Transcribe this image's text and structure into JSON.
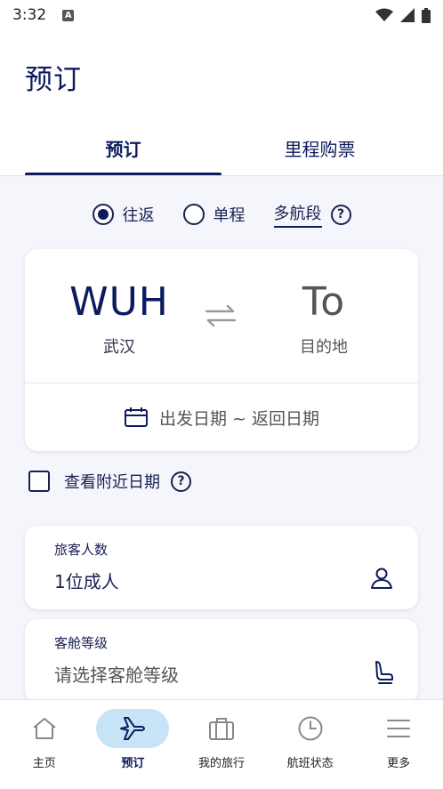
{
  "status_bar": {
    "time": "3:32",
    "notification_icon": "A"
  },
  "header": {
    "title": "预订",
    "tabs": [
      {
        "label": "预订",
        "active": true
      },
      {
        "label": "里程购票",
        "active": false
      }
    ]
  },
  "trip_type": {
    "options": [
      {
        "label": "往返",
        "selected": true
      },
      {
        "label": "单程",
        "selected": false
      }
    ],
    "multi_city_label": "多航段",
    "help": "?"
  },
  "route": {
    "origin_code": "WUH",
    "origin_city": "武汉",
    "dest_code": "To",
    "dest_city": "目的地",
    "date_placeholder": "出发日期 ~ 返回日期"
  },
  "nearby_dates": {
    "label": "查看附近日期",
    "checked": false,
    "help": "?"
  },
  "passengers": {
    "label": "旅客人数",
    "value": "1位成人"
  },
  "cabin": {
    "label": "客舱等级",
    "placeholder": "请选择客舱等级"
  },
  "bottom_nav": [
    {
      "label": "主页",
      "icon": "home-icon",
      "active": false
    },
    {
      "label": "预订",
      "icon": "airplane-icon",
      "active": true
    },
    {
      "label": "我的旅行",
      "icon": "suitcase-icon",
      "active": false
    },
    {
      "label": "航班状态",
      "icon": "clock-icon",
      "active": false
    },
    {
      "label": "更多",
      "icon": "menu-icon",
      "active": false
    }
  ],
  "colors": {
    "primary": "#0c1b5e",
    "nav_active_bg": "#c7e4f7",
    "background": "#f4f6fb"
  }
}
